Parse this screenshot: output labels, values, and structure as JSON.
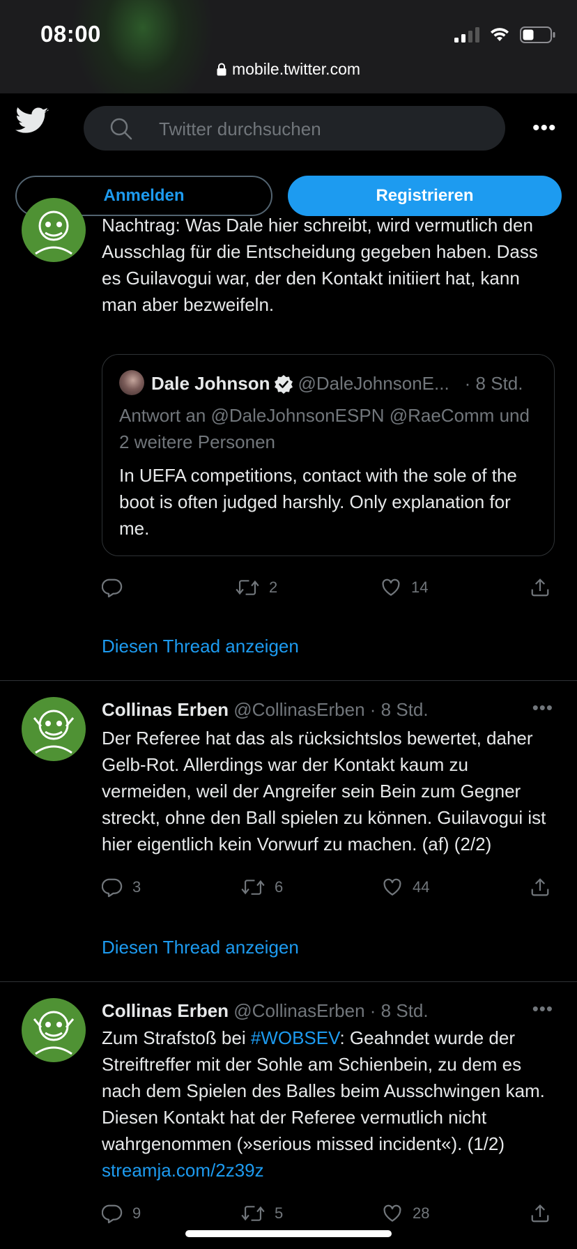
{
  "status_bar": {
    "time": "08:00"
  },
  "browser": {
    "url": "mobile.twitter.com"
  },
  "header": {
    "search_placeholder": "Twitter durchsuchen",
    "login_label": "Anmelden",
    "register_label": "Registrieren"
  },
  "tweets": [
    {
      "text": "Nachtrag: Was Dale hier schreibt, wird vermutlich den Ausschlag für die Entscheidung gegeben haben. Dass es Guilavogui war, der den Kontakt initiiert hat, kann man aber bezweifeln.",
      "quote": {
        "name": "Dale Johnson",
        "handle": "@DaleJohnsonE...",
        "time": "· 8 Std.",
        "reply_to": "Antwort an @DaleJohnsonESPN @RaeComm und 2 weitere Personen",
        "text": "In UEFA competitions, contact with the sole of the boot is often judged harshly. Only explanation for me."
      },
      "replies": "",
      "retweets": "2",
      "likes": "14",
      "thread_link": "Diesen Thread anzeigen"
    },
    {
      "name": "Collinas Erben",
      "handle": "@CollinasErben",
      "time": "· 8 Std.",
      "text": "Der Referee hat das als rücksichtslos bewertet, daher Gelb-Rot. Allerdings war der Kontakt kaum zu vermeiden, weil der Angreifer sein Bein zum Gegner streckt, ohne den Ball spielen zu können. Guilavogui ist hier eigentlich kein Vorwurf zu machen. (af) (2/2)",
      "replies": "3",
      "retweets": "6",
      "likes": "44",
      "thread_link": "Diesen Thread anzeigen"
    },
    {
      "name": "Collinas Erben",
      "handle": "@CollinasErben",
      "time": "· 8 Std.",
      "text_before": "Zum Strafstoß bei ",
      "hashtag": "#WOBSEV",
      "text_after": ": Geahndet wurde der Streiftreffer mit der Sohle am Schienbein, zu dem es nach dem Spielen des Balles beim Ausschwingen kam. Diesen Kontakt hat der Referee vermutlich nicht wahrgenommen (»serious missed incident«). (1/2) ",
      "link": "streamja.com/2z39z",
      "replies": "9",
      "retweets": "5",
      "likes": "28"
    }
  ],
  "colors": {
    "accent": "#1d9bf0",
    "background": "#000000",
    "avatar_green": "#4f9234"
  }
}
